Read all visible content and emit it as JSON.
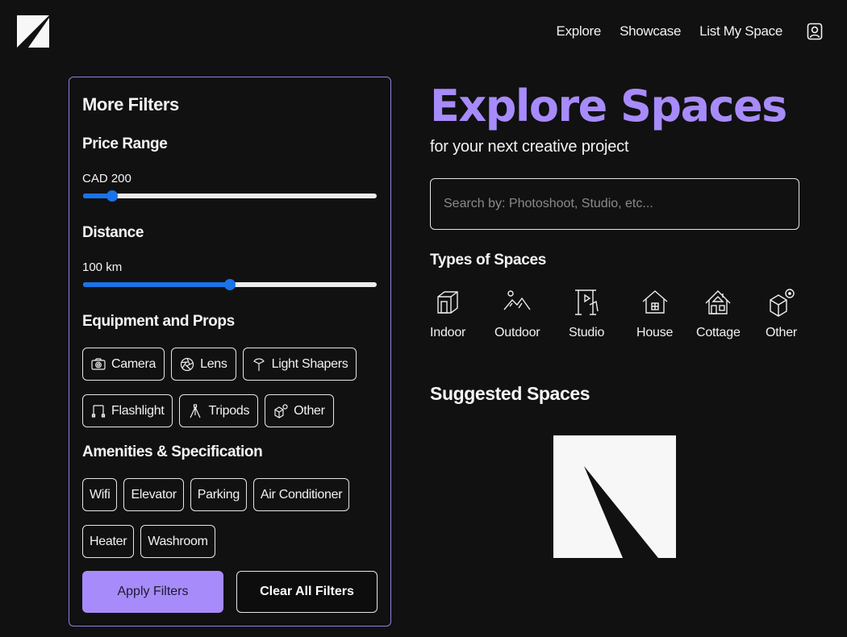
{
  "header": {
    "nav": [
      "Explore",
      "Showcase",
      "List My Space"
    ],
    "user_icon": "user-icon"
  },
  "filters": {
    "title": "More Filters",
    "price": {
      "title": "Price Range",
      "value_label": "CAD 200",
      "fraction": 0.1
    },
    "distance": {
      "title": "Distance",
      "value_label": "100 km",
      "fraction": 0.5
    },
    "equipment": {
      "title": "Equipment and Props",
      "items": [
        {
          "label": "Camera",
          "icon": "camera-icon"
        },
        {
          "label": "Lens",
          "icon": "lens-icon"
        },
        {
          "label": "Light Shapers",
          "icon": "light-shaper-icon"
        },
        {
          "label": "Flashlight",
          "icon": "flashlight-icon"
        },
        {
          "label": "Tripods",
          "icon": "tripod-icon"
        },
        {
          "label": "Other",
          "icon": "other-icon"
        }
      ]
    },
    "amenities": {
      "title": "Amenities & Specification",
      "items": [
        "Wifi",
        "Elevator",
        "Parking",
        "Air Conditioner",
        "Heater",
        "Washroom"
      ]
    },
    "apply_label": "Apply Filters",
    "clear_label": "Clear All Filters"
  },
  "main": {
    "title": "Explore Spaces",
    "subtitle": "for your next creative project",
    "search_placeholder": "Search by: Photoshoot, Studio, etc...",
    "types_title": "Types of Spaces",
    "types": [
      {
        "label": "Indoor",
        "icon": "indoor-icon"
      },
      {
        "label": "Outdoor",
        "icon": "outdoor-icon"
      },
      {
        "label": "Studio",
        "icon": "studio-icon"
      },
      {
        "label": "House",
        "icon": "house-icon"
      },
      {
        "label": "Cottage",
        "icon": "cottage-icon"
      },
      {
        "label": "Other",
        "icon": "other-space-icon"
      }
    ],
    "suggested_title": "Suggested Spaces"
  },
  "colors": {
    "accent": "#a78bfa",
    "slider": "#1a73e8",
    "background": "#111111"
  }
}
